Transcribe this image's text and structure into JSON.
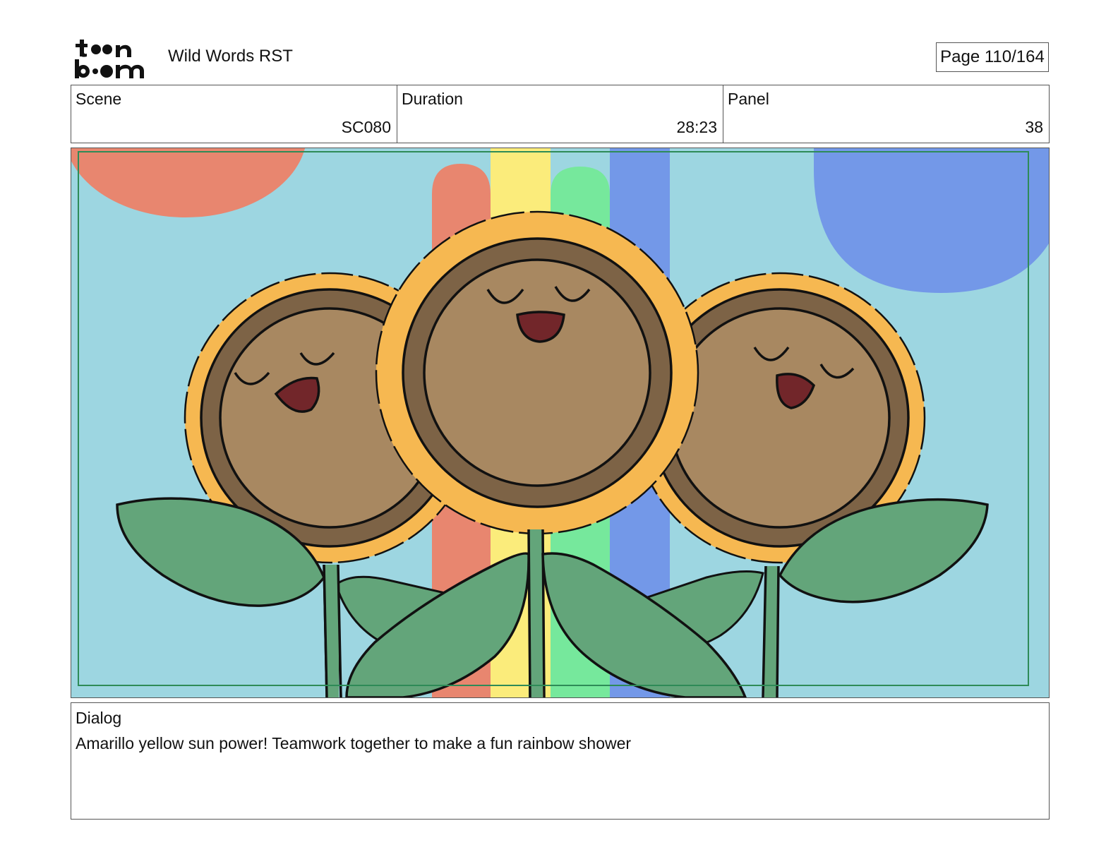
{
  "header": {
    "project_title": "Wild Words RST",
    "page_label": "Page 110/164"
  },
  "info": {
    "scene_label": "Scene",
    "scene_value": "SC080",
    "duration_label": "Duration",
    "duration_value": "28:23",
    "panel_label": "Panel",
    "panel_value": "38"
  },
  "dialog": {
    "label": "Dialog",
    "text": "Amarillo yellow sun power! Teamwork together to make a fun rainbow shower"
  },
  "colors": {
    "sky": "#9dd6e1",
    "sun_coral": "#e8866f",
    "sun_blue": "#7398e8",
    "stripe_red": "#e8866f",
    "stripe_yellow": "#fbec7b",
    "stripe_green": "#76e89c",
    "stripe_blue": "#7398e8",
    "petal": "#f6b851",
    "face_ring": "#7d6346",
    "face": "#a88861",
    "mouth": "#72262a",
    "leaf": "#63a57a",
    "safe_frame": "#2e8b57"
  },
  "icons": {
    "logo": "toon-boom-logo"
  }
}
